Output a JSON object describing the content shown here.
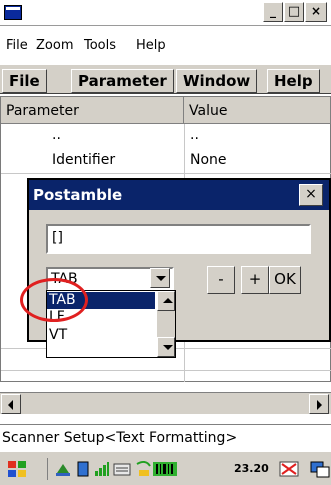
{
  "window": {
    "title": "",
    "min": "_",
    "max": "□",
    "close": "×"
  },
  "menubar1": [
    "File",
    "Zoom",
    "Tools",
    "Help"
  ],
  "menubar2": [
    "File",
    "Parameter",
    "Window",
    "Help"
  ],
  "table": {
    "columns": [
      "Parameter",
      "Value"
    ],
    "rows": [
      {
        "param": "..",
        "value": ".."
      },
      {
        "param": "Identifier",
        "value": "None"
      }
    ]
  },
  "status": {
    "text": "Scanner Setup<Text Formatting>"
  },
  "taskbar": {
    "clock": "23.20"
  },
  "dialog": {
    "title": "Postamble",
    "close": "×",
    "input_value": "[]",
    "combo_value": "TAB",
    "buttons": {
      "minus": "-",
      "plus": "+",
      "ok": "OK"
    },
    "options": [
      "TAB",
      "LF",
      "VT"
    ],
    "selected_option": "TAB"
  },
  "colors": {
    "title_blue": "#0a246a",
    "highlight_circle": "#e02020",
    "face": "#d4d0c8"
  }
}
